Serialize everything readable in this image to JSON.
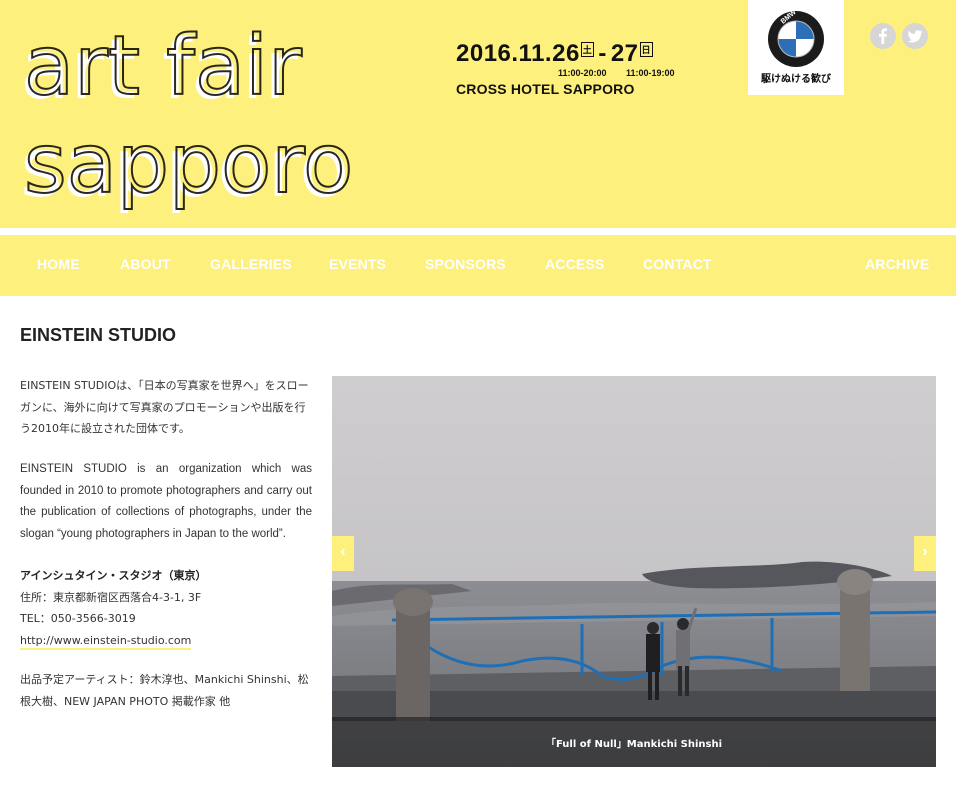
{
  "header": {
    "logo_line1": "art fair",
    "logo_line2": "sapporo",
    "date_start": "2016.11.26",
    "dow_start": "土",
    "date_sep": "-",
    "date_end": "27",
    "dow_end": "日",
    "hours_day1": "11:00-20:00",
    "hours_day2": "11:00-19:00",
    "venue": "CROSS HOTEL SAPPORO"
  },
  "sponsor": {
    "brand": "BMW",
    "tagline": "駆けぬける歓び"
  },
  "social": {
    "facebook_icon": "facebook-icon",
    "twitter_icon": "twitter-icon"
  },
  "nav": {
    "items": [
      {
        "label": "HOME"
      },
      {
        "label": "ABOUT"
      },
      {
        "label": "GALLERIES"
      },
      {
        "label": "EVENTS"
      },
      {
        "label": "SPONSORS"
      },
      {
        "label": "ACCESS"
      },
      {
        "label": "CONTACT"
      },
      {
        "label": "ARCHIVE"
      }
    ]
  },
  "main": {
    "title": "EINSTEIN STUDIO",
    "description_jp": "EINSTEIN STUDIOは、「日本の写真家を世界へ」をスローガンに、海外に向けて写真家のプロモーションや出版を行う2010年に設立された団体です。",
    "description_en": "EINSTEIN STUDIO is an organization which was founded in 2010 to promote photographers and carry out the publication of collections of photographs, under the slogan “young photographers in Japan to the world”.",
    "contact": {
      "name": "アインシュタイン・スタジオ（東京）",
      "address": "住所：東京都新宿区西落合4-3-1, 3F",
      "tel": "TEL：050-3566-3019",
      "url": "http://www.einstein-studio.com"
    },
    "artists": "出品予定アーティスト：鈴木淳也、Mankichi Shinshi、松根大樹、NEW JAPAN PHOTO 掲載作家 他"
  },
  "slider": {
    "caption": "「Full of Null」Mankichi Shinshi",
    "prev_glyph": "‹",
    "next_glyph": "›"
  },
  "colors": {
    "brand_yellow": "#fdf07d",
    "nav_text": "#ffffff",
    "social_gray": "#d6d6d6"
  }
}
